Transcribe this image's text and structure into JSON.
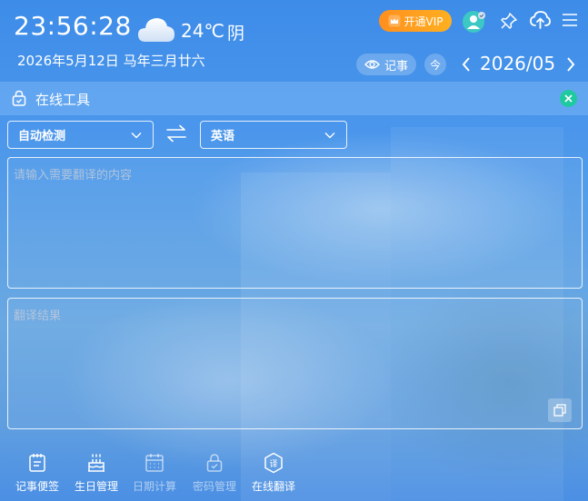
{
  "header": {
    "time": "23:56:28",
    "temperature": "24℃",
    "weather": "阴",
    "weather_icon": "cloud-icon",
    "date": "2026年5月12日 马年三月廿六",
    "vip_label": "开通VIP",
    "note_label": "记事",
    "today_label": "今",
    "month": "2026/05"
  },
  "tool": {
    "title": "在线工具"
  },
  "translate": {
    "source_lang": "自动检测",
    "target_lang": "英语",
    "input_placeholder": "请输入需要翻译的内容",
    "output_placeholder": "翻译结果"
  },
  "nav": {
    "items": [
      {
        "label": "记事便签",
        "icon": "notepad-icon"
      },
      {
        "label": "生日管理",
        "icon": "cake-icon"
      },
      {
        "label": "日期计算",
        "icon": "calendar-grid-icon"
      },
      {
        "label": "密码管理",
        "icon": "lock-icon"
      },
      {
        "label": "在线翻译",
        "icon": "translate-icon"
      }
    ]
  },
  "colors": {
    "vip_gradient_start": "#ff8f1f",
    "vip_gradient_end": "#ffb020",
    "close_button": "#1fc9a0",
    "avatar": "#3cc8c4"
  }
}
